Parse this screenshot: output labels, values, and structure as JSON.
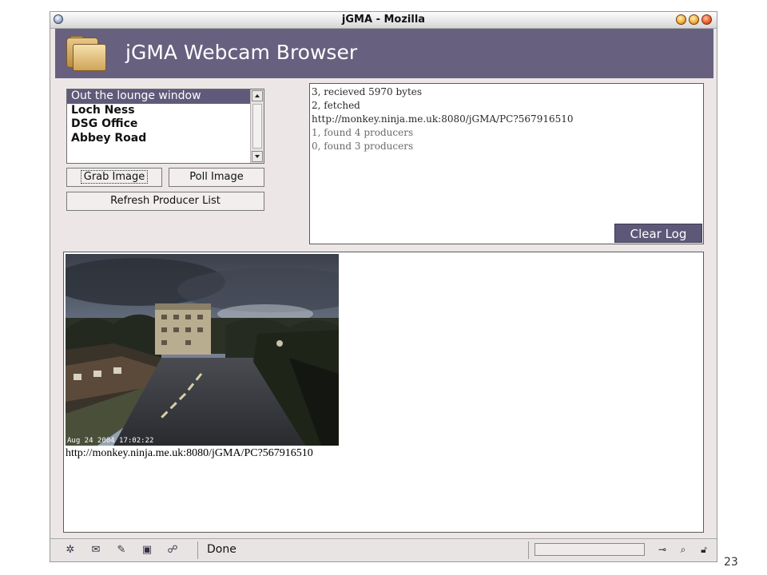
{
  "window": {
    "title": "jGMA - Mozilla"
  },
  "banner": {
    "title": "jGMA Webcam Browser",
    "icon": "folder-icon"
  },
  "producers": {
    "items": [
      "Out the lounge window",
      "Loch Ness",
      "DSG Office",
      "Abbey Road"
    ],
    "selected": "Out the lounge window"
  },
  "buttons": {
    "grab": "Grab Image",
    "poll": "Poll Image",
    "refresh": "Refresh Producer List"
  },
  "log": {
    "lines": [
      "3, recieved 5970 bytes",
      "2, fetched",
      "http://monkey.ninja.me.uk:8080/jGMA/PC?567916510",
      "1, found 4 producers",
      "0, found 3 producers"
    ],
    "clear_label": "Clear Log"
  },
  "image": {
    "timestamp": "Aug 24 2004 17:02:22",
    "url": "http://monkey.ninja.me.uk:8080/jGMA/PC?567916510"
  },
  "statusbar": {
    "text": "Done",
    "left_icons": [
      "navigator-icon",
      "mail-icon",
      "composer-icon",
      "addressbook-icon",
      "chatzilla-icon"
    ],
    "right_icons": [
      "connection-icon",
      "popup-icon",
      "security-lock-icon"
    ]
  },
  "colors": {
    "accent": "#67607f",
    "selection": "#605a7a",
    "window_bg": "#ece6e6"
  },
  "page_number": "23"
}
